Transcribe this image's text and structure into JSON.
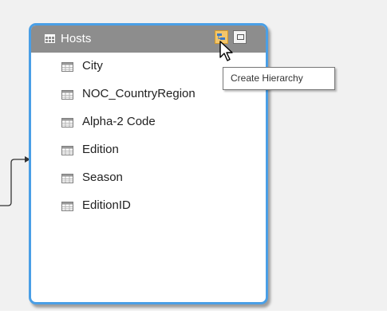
{
  "table": {
    "title": "Hosts",
    "header_color": "#8d8d8d",
    "border_color": "#4a9fe6",
    "icons": {
      "table": "table-icon",
      "create_hierarchy": "create-hierarchy-icon",
      "maximize": "maximize-icon"
    },
    "fields": [
      {
        "label": "City",
        "icon": "column-icon"
      },
      {
        "label": "NOC_CountryRegion",
        "icon": "column-icon"
      },
      {
        "label": "Alpha-2 Code",
        "icon": "column-icon"
      },
      {
        "label": "Edition",
        "icon": "column-icon"
      },
      {
        "label": "Season",
        "icon": "column-icon"
      },
      {
        "label": "EditionID",
        "icon": "column-icon"
      }
    ]
  },
  "tooltip": {
    "text": "Create Hierarchy"
  },
  "relationship": {
    "icon": "relationship-arrow-icon"
  },
  "cursor": {
    "icon": "mouse-pointer-icon"
  }
}
